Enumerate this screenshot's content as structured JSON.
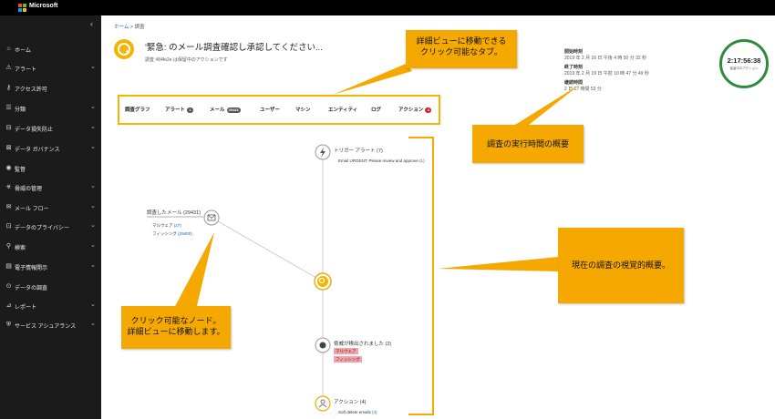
{
  "topbar": {
    "brand": "Microsoft"
  },
  "sidebar": {
    "items": [
      {
        "label": "ホーム",
        "icon": "home-icon",
        "glyph": "⌂",
        "chevron": false
      },
      {
        "label": "アラート",
        "icon": "alert-icon",
        "glyph": "⚠",
        "chevron": true
      },
      {
        "label": "アクセス許可",
        "icon": "key-icon",
        "glyph": "⚷",
        "chevron": false
      },
      {
        "label": "分類",
        "icon": "classification-icon",
        "glyph": "☰",
        "chevron": true
      },
      {
        "label": "データ損失防止",
        "icon": "dlp-icon",
        "glyph": "⊟",
        "chevron": true
      },
      {
        "label": "データ ガバナンス",
        "icon": "lock-icon",
        "glyph": "⊠",
        "chevron": true
      },
      {
        "label": "監督",
        "icon": "eye-icon",
        "glyph": "◉",
        "chevron": false
      },
      {
        "label": "脅威の管理",
        "icon": "biohazard-icon",
        "glyph": "☣",
        "chevron": true
      },
      {
        "label": "メール フロー",
        "icon": "mail-icon",
        "glyph": "✉",
        "chevron": true
      },
      {
        "label": "データのプライバシー",
        "icon": "privacy-lock-icon",
        "glyph": "⊡",
        "chevron": true
      },
      {
        "label": "検索",
        "icon": "search-icon",
        "glyph": "⚲",
        "chevron": true
      },
      {
        "label": "電子情報開示",
        "icon": "ediscovery-icon",
        "glyph": "▤",
        "chevron": true
      },
      {
        "label": "データの調査",
        "icon": "investigation-icon",
        "glyph": "⊙",
        "chevron": false
      },
      {
        "label": "レポート",
        "icon": "chart-icon",
        "glyph": "⊿",
        "chevron": true
      },
      {
        "label": "サービス アシュアランス",
        "icon": "shield-icon",
        "glyph": "⛨",
        "chevron": true
      }
    ]
  },
  "breadcrumb": {
    "home": "ホーム",
    "separator": ">",
    "current": "調査"
  },
  "header": {
    "title": "'緊急: のメール調査確認し承認してください...",
    "subtitle": "調査 #84fe2e は保留中のアクションです"
  },
  "tabs": [
    {
      "label": "調査グラフ"
    },
    {
      "label": "アラート",
      "badge": "1"
    },
    {
      "label": "メール",
      "badge": "29443"
    },
    {
      "label": "ユーザー"
    },
    {
      "label": "マシン"
    },
    {
      "label": "エンティティ"
    },
    {
      "label": "ログ"
    },
    {
      "label": "アクション",
      "badge": "4"
    }
  ],
  "times": {
    "start_label": "開始時刻",
    "start_value": "2019 年 2 月 16 日 午後 4 時 50 分 32 秒",
    "end_label": "終了時刻",
    "end_value": "2019 年 2 月 19 日 午前 10 時 47 分 49 秒",
    "duration_label": "継続時間",
    "duration_value": "2 日 17 時間 53 分"
  },
  "timer": {
    "value": "2:17:56:38",
    "label": "保留中のアクション"
  },
  "graph": {
    "trigger": {
      "title": "トリガー アラート (7)",
      "detail": "Email URGENT: Please review and approve",
      "count": "(1)"
    },
    "emails": {
      "title": "調査したメール (29431)",
      "malware_label": "マルウェア",
      "malware_count": "(27)",
      "phishing_label": "フィッシング",
      "phishing_count": "(29400)"
    },
    "threats": {
      "title": "脅威が検出されました (2)",
      "tags": [
        "マルウェア",
        "フィッシング"
      ]
    },
    "actions": {
      "title": "アクション (4)",
      "detail": "Soft delete emails",
      "count": "(4)"
    }
  },
  "callouts": {
    "tabs": "詳細ビューに移動できる\nクリック可能なタブ。",
    "time": "調査の実行時間の概要",
    "visual": "現在の調査の視覚的概要。",
    "node": "クリック可能なノード。\n詳細ビューに移動します。"
  },
  "colors": {
    "accent": "#f5a800",
    "sidebar": "#1b1b1b",
    "timer_ring": "#2e8b3c",
    "threat_tag": "#f4a3a8",
    "badge_red": "#c4262e"
  }
}
